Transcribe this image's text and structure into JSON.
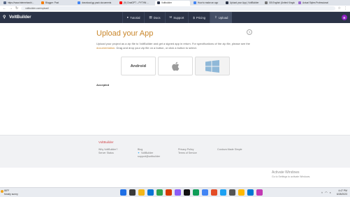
{
  "browser": {
    "tabs": [
      {
        "label": "https://www.internetarchi...",
        "color": "#5b6b8a",
        "active": false
      },
      {
        "label": "Blogger: Post",
        "color": "#f57c00",
        "active": false
      },
      {
        "label": "download gg pack documents",
        "color": "#4285f4",
        "active": false
      },
      {
        "label": "(9) ChatGPT – PYTHN ...",
        "color": "#ff0000",
        "active": false
      },
      {
        "label": "Voltbuilder",
        "color": "#2b3347",
        "active": true
      },
      {
        "label": "How to make an app",
        "color": "#4285f4",
        "active": false
      },
      {
        "label": "Upload your App | VoltBuilder",
        "color": "#2b3347",
        "active": false
      },
      {
        "label": "GB English (United Kingdom)",
        "color": "#777777",
        "active": false
      },
      {
        "label": "Actual Styles Professional",
        "color": "#9a6bd1",
        "active": false
      }
    ],
    "url": "voltbuilder.com/upload/"
  },
  "app": {
    "brand": "VoltBuilder",
    "menu": [
      {
        "label": "Tutorial",
        "icon": "▸"
      },
      {
        "label": "Docs",
        "icon": "▤"
      },
      {
        "label": "Support",
        "icon": "✉"
      },
      {
        "label": "Pricing",
        "icon": "$"
      },
      {
        "label": "Upload",
        "icon": "⇪"
      }
    ],
    "avatar_initial": "E"
  },
  "upload": {
    "title": "Upload your App",
    "help_icon": "?",
    "description_1": "Upload your project as a zip file to VoltBuilder and get a signed app in return. For specifications of the zip file, please see the ",
    "documentation_link": "documentation",
    "description_2": ". Drag and drop your zip file on a button, or click a button to select.",
    "platforms": [
      {
        "name": "android",
        "label": "Android"
      },
      {
        "name": "apple",
        "label": ""
      },
      {
        "name": "windows",
        "label": ""
      }
    ],
    "accepted_label": "Accepted"
  },
  "footer": {
    "brand": "VoltBuilder",
    "col1": [
      "Why VoltBuilder?",
      "Server Status"
    ],
    "col2": [
      "Blog",
      "VoltBuilder",
      "support@voltbuilder"
    ],
    "col3": [
      "Privacy Policy",
      "Terms of Service"
    ],
    "col4": [
      "Cordova Made Simple"
    ]
  },
  "watermark": {
    "title": "Activate Windows",
    "subtitle": "Go to Settings to activate Windows."
  },
  "taskbar": {
    "weather_temp": "88°F",
    "weather_text": "Mostly sunny",
    "time": "4:47 PM",
    "date": "6/28/2023",
    "icons": [
      "#1f6fe5",
      "#3a3a3a",
      "#f3b71a",
      "#0b74d6",
      "#2ea44f",
      "#d83b01",
      "#8b5cf6",
      "#111111",
      "#0f9d58",
      "#4285f4",
      "#e34c26",
      "#1da1f2",
      "#555555",
      "#ffb900",
      "#0078d4",
      "#c239b3"
    ]
  }
}
